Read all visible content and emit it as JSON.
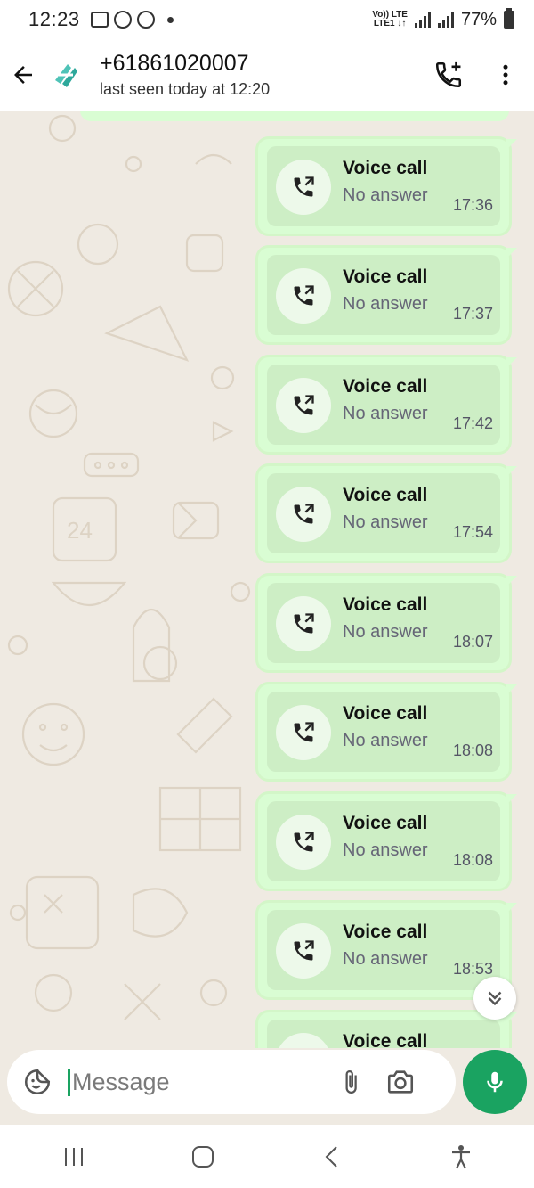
{
  "status_bar": {
    "time": "12:23",
    "network_label_1": "Vo)) LTE",
    "network_label_2": "LTE1 ↓↑",
    "battery": "77%"
  },
  "header": {
    "contact_name": "+61861020007",
    "last_seen": "last seen today at 12:20"
  },
  "messages": [
    {
      "title": "Voice call",
      "subtitle": "No answer",
      "time": "17:36"
    },
    {
      "title": "Voice call",
      "subtitle": "No answer",
      "time": "17:37"
    },
    {
      "title": "Voice call",
      "subtitle": "No answer",
      "time": "17:42"
    },
    {
      "title": "Voice call",
      "subtitle": "No answer",
      "time": "17:54"
    },
    {
      "title": "Voice call",
      "subtitle": "No answer",
      "time": "18:07"
    },
    {
      "title": "Voice call",
      "subtitle": "No answer",
      "time": "18:08"
    },
    {
      "title": "Voice call",
      "subtitle": "No answer",
      "time": "18:08"
    },
    {
      "title": "Voice call",
      "subtitle": "No answer",
      "time": "18:53"
    },
    {
      "title": "Voice call",
      "subtitle": "",
      "time": ""
    }
  ],
  "input": {
    "placeholder": "Message"
  },
  "colors": {
    "accent": "#1aa361",
    "bubble": "#d9fdd3",
    "chat_bg": "#efeae2"
  }
}
